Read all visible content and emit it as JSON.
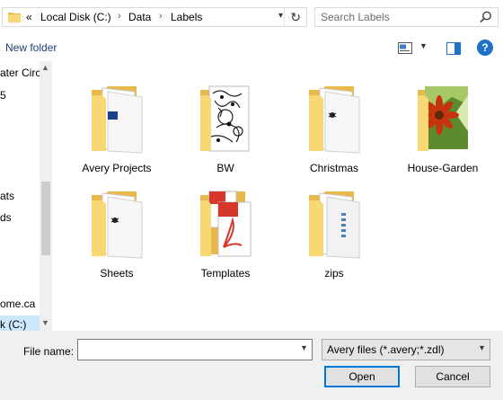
{
  "address": {
    "prefix": "«",
    "crumbs": [
      "Local Disk (C:)",
      "Data",
      "Labels"
    ],
    "separator": "›"
  },
  "search": {
    "placeholder": "Search Labels"
  },
  "toolbar": {
    "new_folder_label": "New folder"
  },
  "help_label": "?",
  "nav": {
    "items": [
      "ater Circ",
      "5",
      "ats",
      "ds",
      "ome.ca",
      "k (C:)"
    ],
    "selected_index": 5
  },
  "files": [
    {
      "name": "Avery Projects",
      "preview": "avery"
    },
    {
      "name": "BW",
      "preview": "bw"
    },
    {
      "name": "Christmas",
      "preview": "doc"
    },
    {
      "name": "House-Garden",
      "preview": "flower"
    },
    {
      "name": "Sheets",
      "preview": "doc"
    },
    {
      "name": "Templates",
      "preview": "pdf"
    },
    {
      "name": "zips",
      "preview": "zip"
    }
  ],
  "bottom": {
    "file_name_label": "File name:",
    "file_name_value": "",
    "filter_value": "Avery files (*.avery;*.zdl)",
    "open_label": "Open",
    "cancel_label": "Cancel"
  },
  "colors": {
    "accent": "#0078d7",
    "folder_back": "#e8b84a",
    "folder_front": "#f8d775",
    "link": "#1e3e73",
    "selection": "#cce8ff"
  }
}
